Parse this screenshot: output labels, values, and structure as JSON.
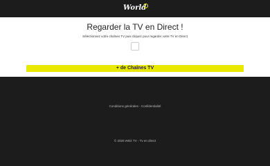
{
  "header": {
    "logo_text": "World"
  },
  "main": {
    "title": "Regarder la TV en Direct !",
    "subtitle": "Sélectionnez votre chaînes TV puis cliquez pour regarder votre TV en Direct",
    "more_channels_label": "+ de Chaînes TV"
  },
  "footer": {
    "links_text": "Conditions générales - Confidentialité",
    "copyright": "© 2020 eWiz TV - Tv en direct"
  },
  "colors": {
    "header_bg": "#1c1c1c",
    "accent": "#e8e800"
  }
}
